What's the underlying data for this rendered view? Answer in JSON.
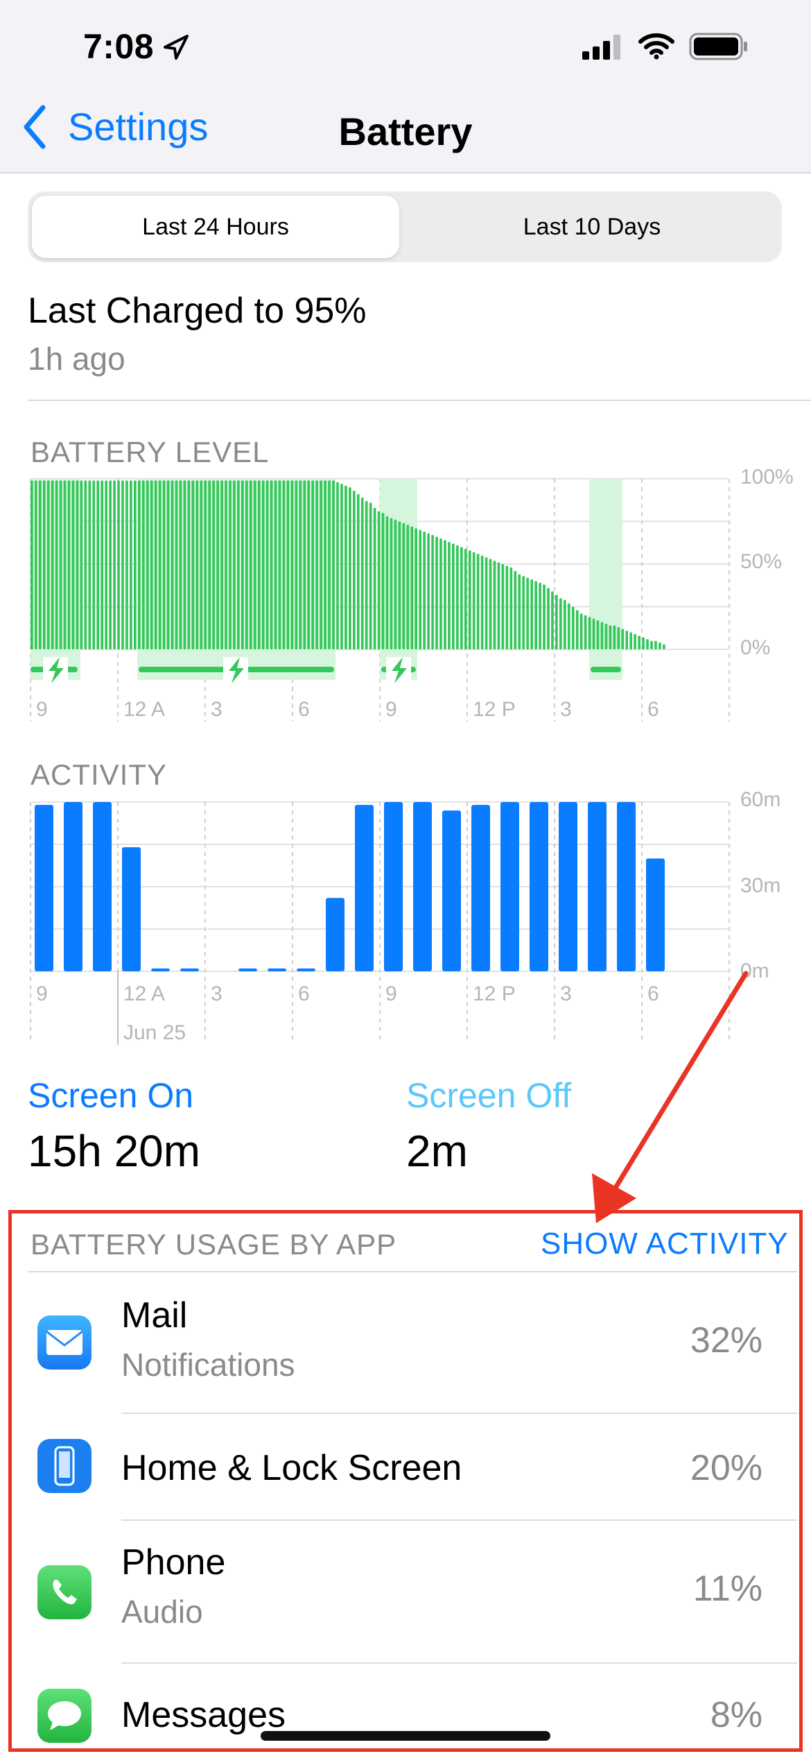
{
  "status": {
    "time": "7:08"
  },
  "nav": {
    "back_label": "Settings",
    "title": "Battery"
  },
  "tabs": [
    {
      "label": "Last 24 Hours",
      "selected": true
    },
    {
      "label": "Last 10 Days",
      "selected": false
    }
  ],
  "last_charged": {
    "title": "Last Charged to 95%",
    "subtitle": "1h ago"
  },
  "battery_chart": {
    "label": "BATTERY LEVEL",
    "y_ticks": [
      "100%",
      "50%",
      "0%"
    ],
    "x_ticks": [
      "9",
      "12 A",
      "3",
      "6",
      "9",
      "12 P",
      "3",
      "6"
    ]
  },
  "activity_chart": {
    "label": "ACTIVITY",
    "y_ticks": [
      "60m",
      "30m",
      "0m"
    ],
    "x_ticks": [
      "9",
      "12 A",
      "3",
      "6",
      "9",
      "12 P",
      "3",
      "6"
    ],
    "date_label": "Jun 25"
  },
  "chart_data": [
    {
      "type": "bar",
      "title": "BATTERY LEVEL",
      "y_unit": "%",
      "ylim": [
        0,
        100
      ],
      "x_tick_labels": [
        "9",
        "12 A",
        "3",
        "6",
        "9",
        "12 P",
        "3",
        "6"
      ],
      "values": [
        99,
        99,
        99,
        99,
        99,
        99,
        99,
        99,
        99,
        99,
        99,
        99,
        99,
        99,
        99,
        99,
        99,
        99,
        99,
        99,
        99,
        99,
        99,
        99,
        99,
        99,
        99,
        99,
        99,
        99,
        99,
        99,
        99,
        99,
        99,
        99,
        99,
        99,
        99,
        99,
        99,
        99,
        99,
        99,
        99,
        99,
        99,
        99,
        99,
        99,
        99,
        99,
        99,
        99,
        99,
        99,
        99,
        99,
        99,
        99,
        99,
        99,
        99,
        99,
        99,
        99,
        99,
        99,
        99,
        99,
        99,
        99,
        99,
        99,
        98,
        97,
        96,
        95,
        93,
        91,
        89,
        87,
        86,
        83,
        81,
        80,
        78,
        77,
        76,
        75,
        74,
        73,
        72,
        71,
        70,
        69,
        68,
        67,
        66,
        65,
        64,
        63,
        62,
        61,
        60,
        59,
        58,
        57,
        56,
        55,
        54,
        53,
        52,
        51,
        50,
        49,
        48,
        46,
        44,
        43,
        42,
        41,
        40,
        39,
        38,
        36,
        34,
        32,
        30,
        29,
        27,
        25,
        23,
        21,
        20,
        19,
        18,
        17,
        16,
        15,
        14,
        14,
        13,
        12,
        11,
        10,
        9,
        8,
        7,
        6,
        5,
        5,
        4,
        3
      ],
      "grid": true
    },
    {
      "type": "bar",
      "title": "ACTIVITY",
      "y_unit": "minutes",
      "ylim": [
        0,
        60
      ],
      "x_tick_labels": [
        "9",
        "12 A",
        "3",
        "6",
        "9",
        "12 P",
        "3",
        "6"
      ],
      "values": [
        59,
        60,
        60,
        44,
        1,
        1,
        0,
        1,
        1,
        1,
        26,
        59,
        60,
        60,
        57,
        59,
        60,
        60,
        60,
        60,
        60,
        40
      ],
      "grid": true
    }
  ],
  "screen_on": {
    "label": "Screen On",
    "value": "15h 20m"
  },
  "screen_off": {
    "label": "Screen Off",
    "value": "2m"
  },
  "usage": {
    "header": "BATTERY USAGE BY APP",
    "action": "SHOW ACTIVITY",
    "apps": [
      {
        "name": "Mail",
        "sub": "Notifications",
        "pct": "32%",
        "icon": "mail-icon",
        "color": "#1d8df5"
      },
      {
        "name": "Home & Lock Screen",
        "sub": "",
        "pct": "20%",
        "icon": "phone-screen-icon",
        "color": "#1c7ff0"
      },
      {
        "name": "Phone",
        "sub": "Audio",
        "pct": "11%",
        "icon": "phone-icon",
        "color": "#30c94f"
      },
      {
        "name": "Messages",
        "sub": "",
        "pct": "8%",
        "icon": "messages-icon",
        "color": "#30c94f"
      }
    ]
  },
  "colors": {
    "accent": "#0a7cff",
    "battery_green": "#34c759",
    "activity_blue": "#0a7cff",
    "highlight_red": "#ea3323"
  }
}
